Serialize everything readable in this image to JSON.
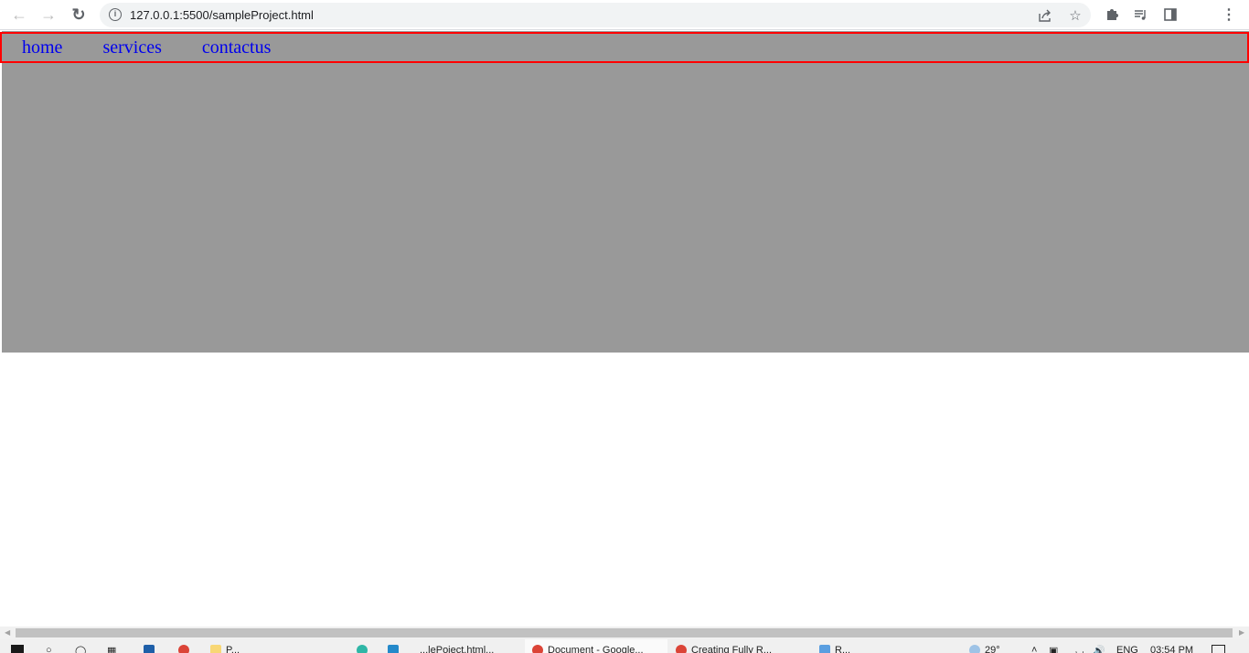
{
  "browser": {
    "url": "127.0.0.1:5500/sampleProject.html",
    "back_label": "Back",
    "forward_label": "Forward",
    "reload_label": "Reload"
  },
  "nav": {
    "items": [
      {
        "label": "home"
      },
      {
        "label": "services"
      },
      {
        "label": "contactus"
      }
    ]
  },
  "colors": {
    "nav_border": "#ff0000",
    "hero_background": "#999999",
    "link": "#0000ee"
  },
  "taskbar": {
    "items": [
      {
        "label": "P..."
      },
      {
        "label": "...lePoject.html..."
      },
      {
        "label": "Document - Google..."
      },
      {
        "label": "Creating Fully R..."
      },
      {
        "label": "R..."
      }
    ],
    "tray": {
      "temp": "29°",
      "lang": "ENG",
      "time": "03:54 PM"
    }
  }
}
